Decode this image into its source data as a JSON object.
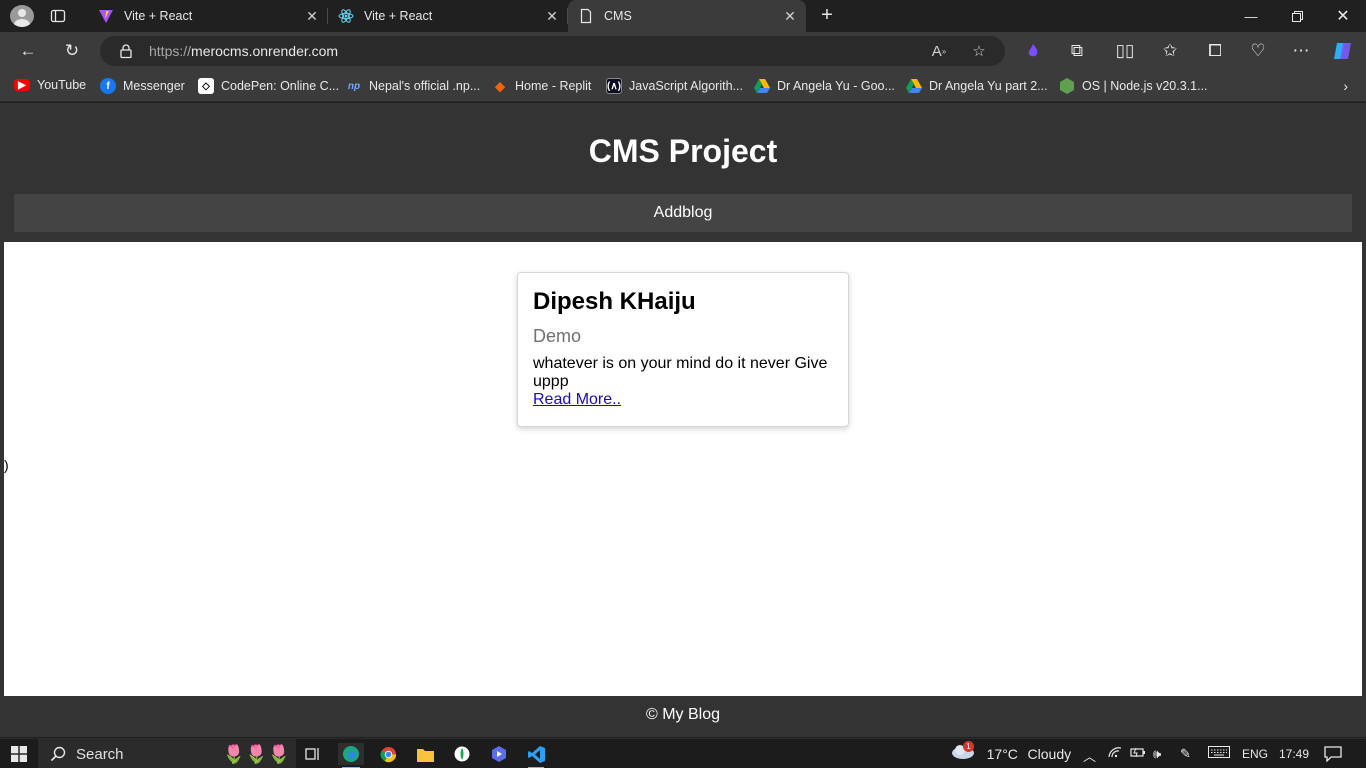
{
  "browser": {
    "tabs": [
      {
        "title": "Vite + React",
        "favicon": "vite-icon"
      },
      {
        "title": "Vite + React",
        "favicon": "react-icon"
      },
      {
        "title": "CMS",
        "favicon": "page-icon",
        "active": true
      }
    ],
    "url_scheme": "https://",
    "url_host": "merocms.onrender.com",
    "bookmarks": [
      {
        "label": "YouTube",
        "icon": "youtube-icon"
      },
      {
        "label": "Messenger",
        "icon": "facebook-icon"
      },
      {
        "label": "CodePen: Online C...",
        "icon": "codepen-icon"
      },
      {
        "label": "Nepal's official .np...",
        "icon": "np-icon"
      },
      {
        "label": "Home - Replit",
        "icon": "replit-icon"
      },
      {
        "label": "JavaScript Algorith...",
        "icon": "freecodecamp-icon"
      },
      {
        "label": "Dr Angela Yu - Goo...",
        "icon": "google-drive-icon"
      },
      {
        "label": "Dr Angela Yu part 2...",
        "icon": "google-drive-icon"
      },
      {
        "label": "OS | Node.js v20.3.1...",
        "icon": "nodejs-icon"
      }
    ]
  },
  "site": {
    "title": "CMS Project",
    "nav_addblog": "Addblog",
    "card": {
      "title": "Dipesh KHaiju",
      "subtitle": "Demo",
      "description": "whatever is on your mind do it never Give uppp",
      "link": "Read More.."
    },
    "stray_text": ")",
    "footer": "© My Blog"
  },
  "taskbar": {
    "search_placeholder": "Search",
    "weather_temp": "17°C",
    "weather_desc": "Cloudy",
    "weather_badge": "1",
    "language": "ENG",
    "time": "17:49"
  },
  "colors": {
    "page_header": "#333333",
    "nav_bar": "#444444",
    "link": "#1a0dab"
  }
}
